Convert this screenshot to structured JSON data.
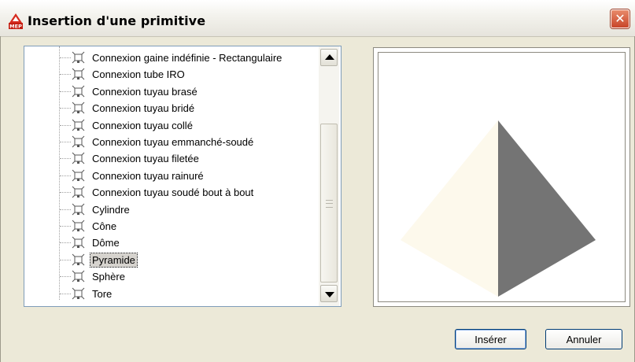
{
  "window": {
    "title": "Insertion d'une primitive",
    "app_icon": "autocad-mep-icon",
    "close_icon": "close-icon"
  },
  "tree": {
    "items": [
      {
        "label": "Connexion gaine indéfinie - Rectangulaire",
        "icon": "primitive-node-icon",
        "selected": false
      },
      {
        "label": "Connexion tube IRO",
        "icon": "primitive-node-icon",
        "selected": false
      },
      {
        "label": "Connexion tuyau brasé",
        "icon": "primitive-node-icon",
        "selected": false
      },
      {
        "label": "Connexion tuyau bridé",
        "icon": "primitive-node-icon",
        "selected": false
      },
      {
        "label": "Connexion tuyau collé",
        "icon": "primitive-node-icon",
        "selected": false
      },
      {
        "label": "Connexion tuyau emmanché-soudé",
        "icon": "primitive-node-icon",
        "selected": false
      },
      {
        "label": "Connexion tuyau filetée",
        "icon": "primitive-node-icon",
        "selected": false
      },
      {
        "label": "Connexion tuyau rainuré",
        "icon": "primitive-node-icon",
        "selected": false
      },
      {
        "label": "Connexion tuyau soudé bout à bout",
        "icon": "primitive-node-icon",
        "selected": false
      },
      {
        "label": "Cylindre",
        "icon": "primitive-node-icon",
        "selected": false
      },
      {
        "label": "Cône",
        "icon": "primitive-node-icon",
        "selected": false
      },
      {
        "label": "Dôme",
        "icon": "primitive-node-icon",
        "selected": false
      },
      {
        "label": "Pyramide",
        "icon": "primitive-node-icon",
        "selected": true
      },
      {
        "label": "Sphère",
        "icon": "primitive-node-icon",
        "selected": false
      },
      {
        "label": "Tore",
        "icon": "primitive-node-icon",
        "selected": false
      }
    ]
  },
  "preview": {
    "shape": "pyramid",
    "light_face_color": "#fdf9ec",
    "dark_face_color": "#747474"
  },
  "buttons": {
    "insert_label": "Insérer",
    "cancel_label": "Annuler"
  },
  "colors": {
    "dialog_bg": "#ece9d8",
    "close_button": "#d3532f",
    "selection_bg": "#d6d3ce"
  }
}
